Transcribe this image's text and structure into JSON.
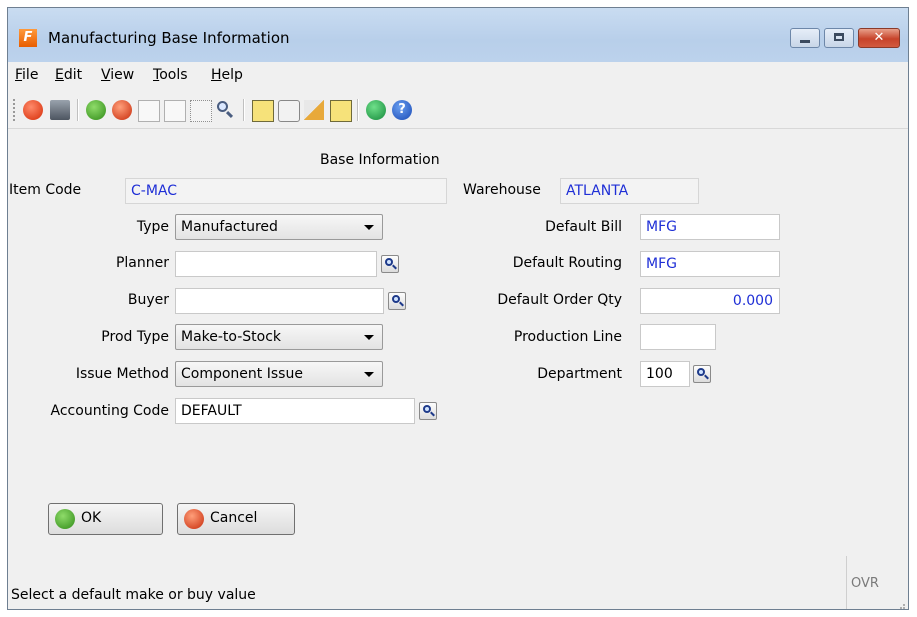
{
  "window": {
    "title": "Manufacturing Base Information"
  },
  "menu": [
    {
      "pre": "",
      "key": "F",
      "post": "ile"
    },
    {
      "pre": "",
      "key": "E",
      "post": "dit"
    },
    {
      "pre": "",
      "key": "V",
      "post": "iew"
    },
    {
      "pre": "",
      "key": "T",
      "post": "ools"
    },
    {
      "pre": "",
      "key": "H",
      "post": "elp"
    }
  ],
  "toolbar": {
    "icons": [
      "power-icon",
      "save-icon",
      "ok-icon",
      "cancel-icon",
      "copy-icon",
      "paste-icon",
      "select-icon",
      "search-icon",
      "notes-icon",
      "attachment-icon",
      "lookup-user-icon",
      "checklist-icon",
      "chart-icon",
      "help-icon"
    ]
  },
  "form": {
    "section_title": "Base Information",
    "item_code_label": "Item Code",
    "item_code_value": "C-MAC",
    "warehouse_label": "Warehouse",
    "warehouse_value": "ATLANTA",
    "type_label": "Type",
    "type_value": "Manufactured",
    "planner_label": "Planner",
    "planner_value": "",
    "buyer_label": "Buyer",
    "buyer_value": "",
    "prod_type_label": "Prod Type",
    "prod_type_value": "Make-to-Stock",
    "issue_method_label": "Issue Method",
    "issue_method_value": "Component Issue",
    "accounting_code_label": "Accounting Code",
    "accounting_code_value": "DEFAULT",
    "default_bill_label": "Default Bill",
    "default_bill_value": "MFG",
    "default_routing_label": "Default Routing",
    "default_routing_value": "MFG",
    "default_order_qty_label": "Default Order Qty",
    "default_order_qty_value": "0.000",
    "production_line_label": "Production Line",
    "production_line_value": "",
    "department_label": "Department",
    "department_value": "100"
  },
  "buttons": {
    "ok": "OK",
    "cancel": "Cancel"
  },
  "status": {
    "message": "Select a default make or buy value",
    "mode": "OVR"
  },
  "colors": {
    "value_text": "#1f2fd6",
    "titlebar": "#b8cfea"
  }
}
